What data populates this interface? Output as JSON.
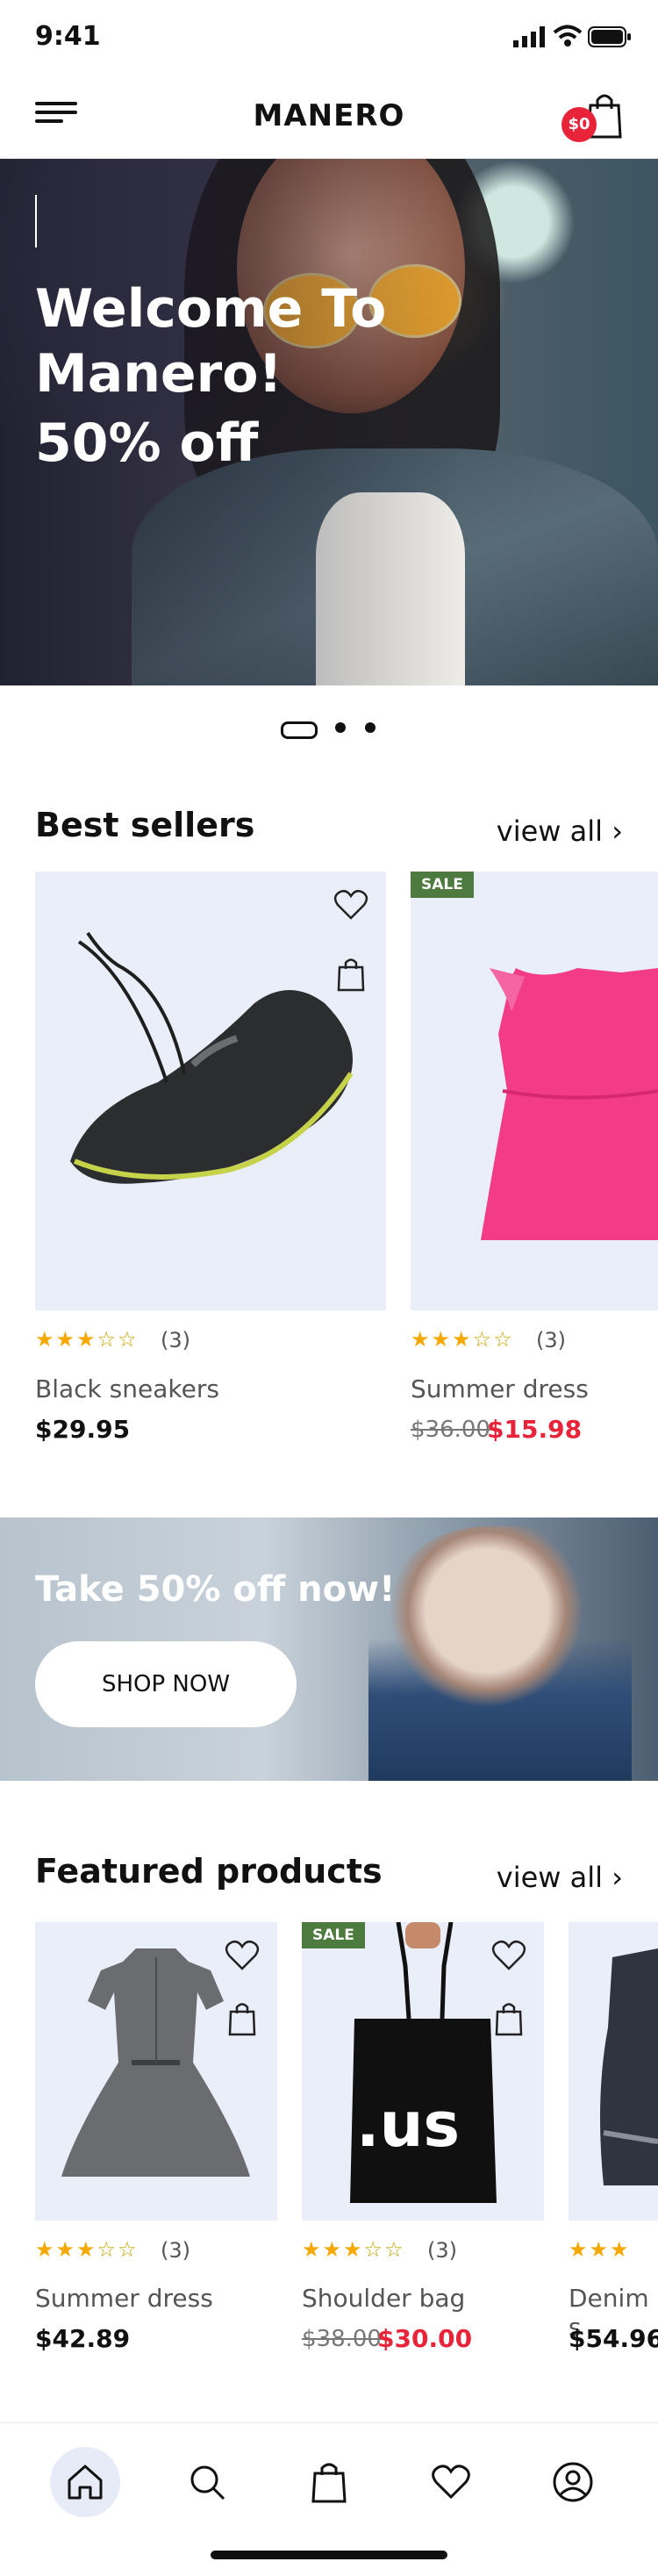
{
  "status": {
    "time": "9:41"
  },
  "header": {
    "logo": "MANERO",
    "cart_amount": "$0"
  },
  "hero": {
    "title": "Welcome To Manero!",
    "subtitle": "50% off"
  },
  "best_sellers": {
    "title": "Best sellers",
    "view_all": "view  all",
    "products": [
      {
        "name": "Black sneakers",
        "rating": 3,
        "reviews": "(3)",
        "price": "$29.95"
      },
      {
        "name": "Summer dress",
        "rating": 3,
        "reviews": "(3)",
        "old_price": "$36.00",
        "price": "$15.98",
        "badge": "SALE"
      }
    ]
  },
  "promo": {
    "text": "Take 50% off now!",
    "button": "SHOP NOW"
  },
  "featured": {
    "title": "Featured products",
    "view_all": "view  all",
    "products": [
      {
        "name": "Summer dress",
        "rating": 3,
        "reviews": "(3)",
        "price": "$42.89"
      },
      {
        "name": "Shoulder bag",
        "rating": 3,
        "reviews": "(3)",
        "old_price": "$38.00",
        "price": "$30.00",
        "badge": "SALE",
        "bag_print": ".us"
      },
      {
        "name": "Denim s",
        "rating": 3,
        "reviews": "(3)",
        "price": "$54.96"
      }
    ]
  },
  "stars": {
    "on": "★★★",
    "off": "☆☆"
  },
  "nav": [
    "home-icon",
    "search-icon",
    "bag-icon",
    "heart-icon",
    "profile-icon"
  ],
  "colors": {
    "sale_badge": "#4c7a3f",
    "sale_price": "#e8243b",
    "card_bg": "#e9eef9",
    "star": "#f5a800",
    "cart_badge": "#e8243b"
  }
}
